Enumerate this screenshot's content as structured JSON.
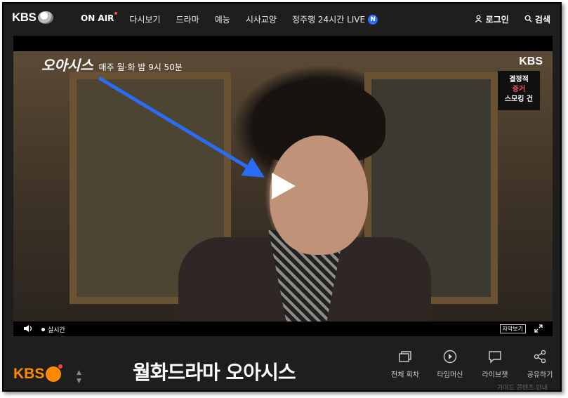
{
  "header": {
    "logo_text": "KBS",
    "menu": [
      "ON AIR",
      "다시보기",
      "드라마",
      "예능",
      "시사교양"
    ],
    "live_label": "정주행 24시간 LIVE",
    "live_badge": "N",
    "login_label": "로그인",
    "search_label": "검색"
  },
  "player": {
    "overlay_title": "오아시스",
    "schedule": "매주 월·화 밤 9시 50분",
    "watermark": "KBS",
    "promo": [
      "결정적",
      "증거",
      "스모킹 건"
    ],
    "live_indicator": "실시간",
    "subtitle_button": "자막보기"
  },
  "bottom": {
    "logo_text": "KBS",
    "show_title": "월화드라마 오아시스",
    "actions": [
      "전체 회차",
      "타임머신",
      "라이브챗",
      "공유하기"
    ],
    "footer_text": "가이드 콘텐츠 안내"
  }
}
